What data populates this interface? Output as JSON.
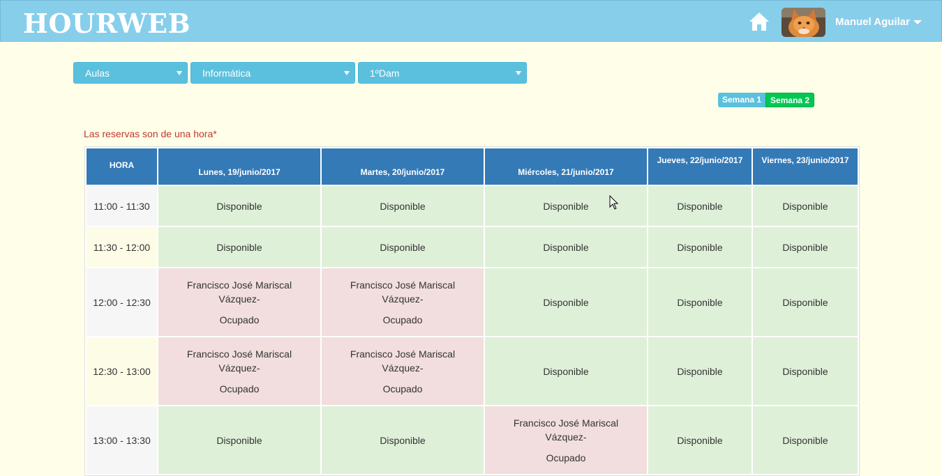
{
  "header": {
    "brand": "HOURWEB",
    "user_name": "Manuel Aguilar",
    "home_icon": "home-icon",
    "avatar": "cat-photo"
  },
  "filters": {
    "type": "Aulas",
    "room": "Informática",
    "group": "1ºDam"
  },
  "weeks": {
    "week1": "Semana 1",
    "week2": "Semana 2",
    "active": "Semana 2"
  },
  "notice": "Las reservas son de una hora*",
  "schedule": {
    "hour_header": "HORA",
    "days": [
      "Lunes, 19/junio/2017",
      "Martes, 20/junio/2017",
      "Miércoles, 21/junio/2017",
      "Jueves, 22/junio/2017",
      "Viernes, 23/junio/2017"
    ],
    "rows": [
      {
        "hour": "11:00 - 11:30",
        "cells": [
          {
            "status": "Disponible"
          },
          {
            "status": "Disponible"
          },
          {
            "status": "Disponible"
          },
          {
            "status": "Disponible"
          },
          {
            "status": "Disponible"
          }
        ]
      },
      {
        "hour": "11:30 - 12:00",
        "cells": [
          {
            "status": "Disponible"
          },
          {
            "status": "Disponible"
          },
          {
            "status": "Disponible"
          },
          {
            "status": "Disponible"
          },
          {
            "status": "Disponible"
          }
        ]
      },
      {
        "hour": "12:00 - 12:30",
        "cells": [
          {
            "name": "Francisco José Mariscal Vázquez-",
            "status": "Ocupado"
          },
          {
            "name": "Francisco José Mariscal Vázquez-",
            "status": "Ocupado"
          },
          {
            "status": "Disponible"
          },
          {
            "status": "Disponible"
          },
          {
            "status": "Disponible"
          }
        ]
      },
      {
        "hour": "12:30 - 13:00",
        "cells": [
          {
            "name": "Francisco José Mariscal Vázquez-",
            "status": "Ocupado"
          },
          {
            "name": "Francisco José Mariscal Vázquez-",
            "status": "Ocupado"
          },
          {
            "status": "Disponible"
          },
          {
            "status": "Disponible"
          },
          {
            "status": "Disponible"
          }
        ]
      },
      {
        "hour": "13:00 - 13:30",
        "cells": [
          {
            "status": "Disponible"
          },
          {
            "status": "Disponible"
          },
          {
            "name": "Francisco José Mariscal Vázquez-",
            "status": "Ocupado"
          },
          {
            "status": "Disponible"
          },
          {
            "status": "Disponible"
          }
        ]
      }
    ]
  },
  "colors": {
    "header_bg": "#87ceeb",
    "page_bg": "#fefee9",
    "select_bg": "#5bc0de",
    "table_head": "#337ab7",
    "free": "#dff0d8",
    "busy": "#f2dede",
    "week_active": "#00c853",
    "notice": "#c0392b"
  }
}
